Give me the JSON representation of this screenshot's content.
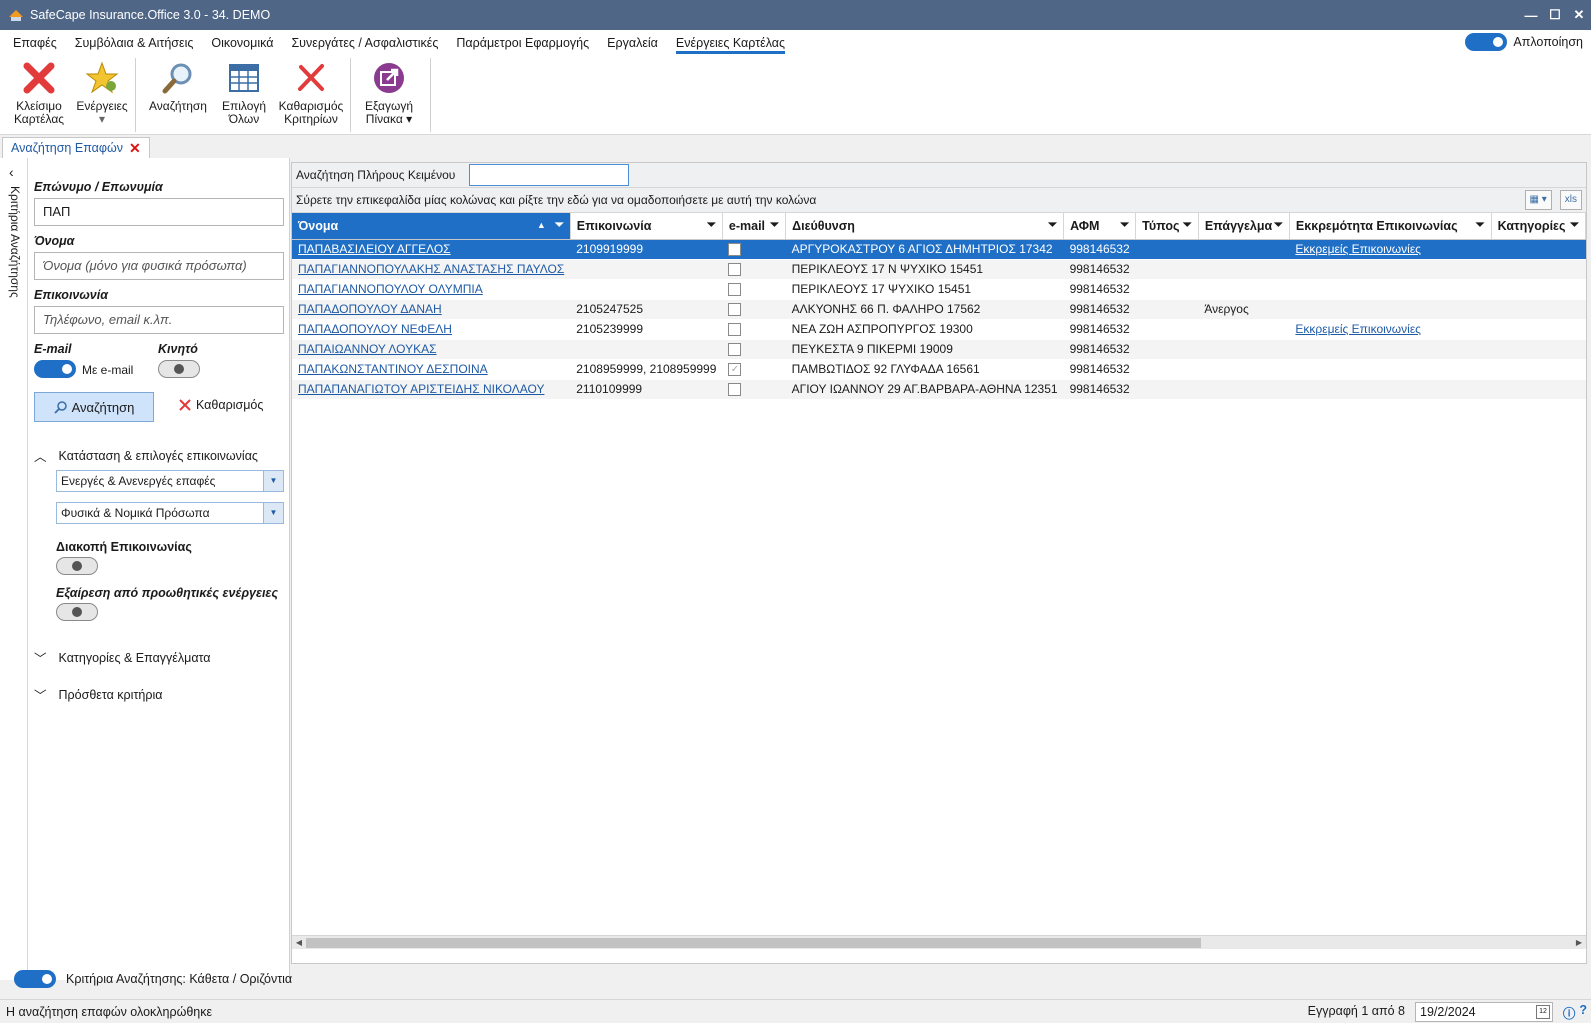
{
  "window": {
    "title": "SafeCape Insurance.Office 3.0 - 34. DEMO",
    "minimize": "—",
    "maximize": "☐",
    "close": "✕"
  },
  "menu": {
    "items": [
      {
        "label": "Επαφές"
      },
      {
        "label": "Συμβόλαια & Αιτήσεις"
      },
      {
        "label": "Οικονομικά"
      },
      {
        "label": "Συνεργάτες / Ασφαλιστικές"
      },
      {
        "label": "Παράμετροι Εφαρμογής"
      },
      {
        "label": "Εργαλεία"
      },
      {
        "label": "Ενέργειες Καρτέλας"
      }
    ],
    "simplify_label": "Απλοποίηση"
  },
  "ribbon": {
    "close_tab": {
      "line1": "Κλείσιμο",
      "line2": "Καρτέλας",
      "icon": "close-x-icon"
    },
    "actions": {
      "line1": "Ενέργειες",
      "line2": "▾",
      "icon": "star-icon"
    },
    "search": {
      "line1": "Αναζήτηση",
      "icon": "magnifier-icon"
    },
    "select_all": {
      "line1": "Επιλογή",
      "line2": "Όλων",
      "icon": "table-icon"
    },
    "clear_criteria": {
      "line1": "Καθαρισμός",
      "line2": "Κριτηρίων",
      "icon": "clear-x-icon"
    },
    "export": {
      "line1": "Εξαγωγή",
      "line2": "Πίνακα ▾",
      "icon": "export-icon"
    }
  },
  "doc_tab": {
    "label": "Αναζήτηση Επαφών"
  },
  "criteria": {
    "side_label": "Κριτήρια Αναζήτησης",
    "surname_label": "Επώνυμο / Επωνυμία",
    "surname_value": "ΠΑΠ",
    "name_label": "Όνομα",
    "name_placeholder": "Όνομα (μόνο για φυσικά πρόσωπα)",
    "contact_label": "Επικοινωνία",
    "contact_placeholder": "Τηλέφωνο, email κ.λπ.",
    "email_label": "E-mail",
    "email_toggle_text": "Με e-mail",
    "mobile_label": "Κινητό",
    "search_button": "Αναζήτηση",
    "clear_button": "Καθαρισμός",
    "status_section": "Κατάσταση & επιλογές επικοινωνίας",
    "status_combo": "Ενεργές & Ανενεργές επαφές",
    "person_combo": "Φυσικά & Νομικά Πρόσωπα",
    "stop_comm_label": "Διακοπή Επικοινωνίας",
    "exclude_promo_label": "Εξαίρεση από προωθητικές ενέργειες",
    "categories_section": "Κατηγορίες & Επαγγέλματα",
    "extra_section": "Πρόσθετα κριτήρια",
    "layout_toggle_label": "Κριτήρια Αναζήτησης: Κάθετα / Οριζόντια"
  },
  "grid": {
    "fulltext_label": "Αναζήτηση Πλήρους Κειμένου",
    "fulltext_value": "",
    "group_hint": "Σύρετε την επικεφαλίδα μίας κολώνας και ρίξτε την εδώ για να ομαδοποιήσετε με αυτή την κολώνα",
    "columns": [
      "Όνομα",
      "Επικοινωνία",
      "e-mail",
      "Διεύθυνση",
      "ΑΦΜ",
      "Τύπος",
      "Επάγγελμα",
      "Εκκρεμότητα Επικοινωνίας",
      "Κατηγορίες"
    ],
    "rows": [
      {
        "name": "ΠΑΠΑΒΑΣΙΛΕΙΟΥ ΑΓΓΕΛΟΣ",
        "contact": "2109919999",
        "email": false,
        "address": "ΑΡΓΥΡΟΚΑΣΤΡΟΥ 6 ΑΓΙΟΣ ΔΗΜΗΤΡΙΟΣ 17342",
        "afm": "998146532",
        "type": "",
        "job": "",
        "pending": "Εκκρεμείς Επικοινωνίες",
        "cats": ""
      },
      {
        "name": "ΠΑΠΑΓΙΑΝΝΟΠΟΥΛΑΚΗΣ ΑΝΑΣΤΑΣΗΣ ΠΑΥΛΟΣ",
        "contact": "",
        "email": false,
        "address": "ΠΕΡΙΚΛΕΟΥΣ 17 Ν ΨΥΧΙΚΟ 15451",
        "afm": "998146532",
        "type": "",
        "job": "",
        "pending": "",
        "cats": ""
      },
      {
        "name": "ΠΑΠΑΓΙΑΝΝΟΠΟΥΛΟΥ ΟΛΥΜΠΙΑ",
        "contact": "",
        "email": false,
        "address": "ΠΕΡΙΚΛΕΟΥΣ 17 ΨΥΧΙΚΟ 15451",
        "afm": "998146532",
        "type": "",
        "job": "",
        "pending": "",
        "cats": ""
      },
      {
        "name": "ΠΑΠΑΔΟΠΟΥΛΟΥ ΔΑΝΑΗ",
        "contact": "2105247525",
        "email": false,
        "address": "ΑΛΚΥΟΝΗΣ 66 Π. ΦΑΛΗΡΟ 17562",
        "afm": "998146532",
        "type": "",
        "job": "Άνεργος",
        "pending": "",
        "cats": ""
      },
      {
        "name": "ΠΑΠΑΔΟΠΟΥΛΟΥ ΝΕΦΕΛΗ",
        "contact": "2105239999",
        "email": false,
        "address": "ΝΕΑ ΖΩΗ ΑΣΠΡΟΠΥΡΓΟΣ 19300",
        "afm": "998146532",
        "type": "",
        "job": "",
        "pending": "Εκκρεμείς Επικοινωνίες",
        "cats": ""
      },
      {
        "name": "ΠΑΠΑΙΩΑΝΝΟΥ ΛΟΥΚΑΣ",
        "contact": "",
        "email": false,
        "address": "ΠΕΥΚΕΣΤΑ 9 ΠΙΚΕΡΜΙ 19009",
        "afm": "998146532",
        "type": "",
        "job": "",
        "pending": "",
        "cats": ""
      },
      {
        "name": "ΠΑΠΑΚΩΝΣΤΑΝΤΙΝΟΥ ΔΕΣΠΟΙΝΑ",
        "contact": "2108959999, 2108959999",
        "email": true,
        "address": "ΠΑΜΒΩΤΙΔΟΣ 92 ΓΛΥΦΑΔΑ 16561",
        "afm": "998146532",
        "type": "",
        "job": "",
        "pending": "",
        "cats": ""
      },
      {
        "name": "ΠΑΠΑΠΑΝΑΓΙΩΤΟΥ ΑΡΙΣΤΕΙΔΗΣ ΝΙΚΟΛΑΟΥ",
        "contact": "2110109999",
        "email": false,
        "address": "ΑΓΙΟΥ ΙΩΑΝΝΟΥ 29 ΑΓ.ΒΑΡΒΑΡΑ-ΑΘΗΝΑ 12351",
        "afm": "998146532",
        "type": "",
        "job": "",
        "pending": "",
        "cats": ""
      }
    ]
  },
  "status": {
    "message": "Η αναζήτηση επαφών ολοκληρώθηκε",
    "record": "Εγγραφή 1 από 8",
    "date": "19/2/2024",
    "calendar_day": "12"
  }
}
